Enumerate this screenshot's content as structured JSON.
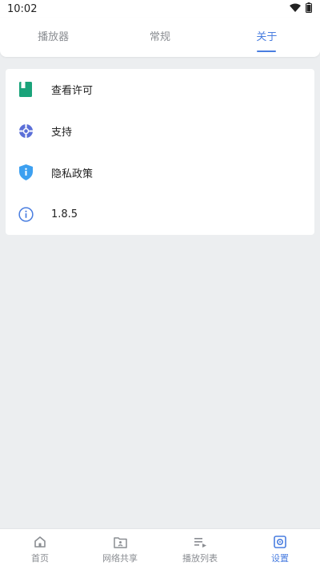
{
  "status_bar": {
    "time": "10:02",
    "wifi_icon": "wifi-icon",
    "battery_icon": "battery-icon"
  },
  "tabs": [
    {
      "label": "播放器",
      "active": false
    },
    {
      "label": "常规",
      "active": false
    },
    {
      "label": "关于",
      "active": true
    }
  ],
  "about_items": [
    {
      "label": "查看许可",
      "icon": "license-book-icon",
      "icon_color": "#1aa37a"
    },
    {
      "label": "支持",
      "icon": "lifebuoy-icon",
      "icon_color": "#5b6fd8"
    },
    {
      "label": "隐私政策",
      "icon": "shield-info-icon",
      "icon_color": "#3da0f0"
    },
    {
      "label": "1.8.5",
      "icon": "info-icon",
      "icon_color": "#4a7ee0"
    }
  ],
  "bottom_nav": [
    {
      "label": "首页",
      "icon": "home-icon",
      "active": false
    },
    {
      "label": "网络共享",
      "icon": "network-folder-icon",
      "active": false
    },
    {
      "label": "播放列表",
      "icon": "playlist-icon",
      "active": false
    },
    {
      "label": "设置",
      "icon": "settings-icon",
      "active": true
    }
  ],
  "colors": {
    "accent": "#4a7ee0",
    "inactive": "#8a8d92",
    "background": "#eceef0"
  }
}
